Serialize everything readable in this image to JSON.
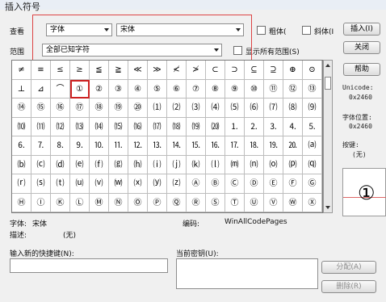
{
  "window": {
    "title": "插入符号"
  },
  "toolbar": {
    "view_label": "查看",
    "view_value": "字体",
    "font_value": "宋体",
    "bold_label": "粗体(",
    "italic_label": "斜体(I",
    "range_label": "范围",
    "range_value": "全部已知字符",
    "show_all_label": "显示所有范围(S)"
  },
  "buttons": {
    "insert": "插入(I)",
    "close": "关闭",
    "help": "帮助",
    "assign": "分配(A)",
    "delete": "删除(R)"
  },
  "symbols": [
    "≠",
    "≡",
    "≤",
    "≥",
    "≦",
    "≧",
    "≪",
    "≫",
    "≮",
    "≯",
    "⊂",
    "⊃",
    "⊆",
    "⊇",
    "⊕",
    "⊙",
    "⊥",
    "⊿",
    "⌒",
    "①",
    "②",
    "③",
    "④",
    "⑤",
    "⑥",
    "⑦",
    "⑧",
    "⑨",
    "⑩",
    "⑪",
    "⑫",
    "⑬",
    "⑭",
    "⑮",
    "⑯",
    "⑰",
    "⑱",
    "⑲",
    "⑳",
    "⑴",
    "⑵",
    "⑶",
    "⑷",
    "⑸",
    "⑹",
    "⑺",
    "⑻",
    "⑼",
    "⑽",
    "⑾",
    "⑿",
    "⒀",
    "⒁",
    "⒂",
    "⒃",
    "⒄",
    "⒅",
    "⒆",
    "⒇",
    "⒈",
    "⒉",
    "⒊",
    "⒋",
    "⒌",
    "⒍",
    "⒎",
    "⒏",
    "⒐",
    "⒑",
    "⒒",
    "⒓",
    "⒔",
    "⒕",
    "⒖",
    "⒗",
    "⒘",
    "⒙",
    "⒚",
    "⒛",
    "⒜",
    "⒝",
    "⒞",
    "⒟",
    "⒠",
    "⒡",
    "⒢",
    "⒣",
    "⒤",
    "⒥",
    "⒦",
    "⒧",
    "⒨",
    "⒩",
    "⒪",
    "⒫",
    "⒬",
    "⒭",
    "⒮",
    "⒯",
    "⒰",
    "⒱",
    "⒲",
    "⒳",
    "⒴",
    "⒵",
    "Ⓐ",
    "Ⓑ",
    "Ⓒ",
    "Ⓓ",
    "Ⓔ",
    "Ⓕ",
    "Ⓖ",
    "Ⓗ",
    "Ⓘ",
    "Ⓚ",
    "Ⓛ",
    "Ⓜ",
    "Ⓝ",
    "Ⓞ",
    "Ⓟ",
    "Ⓠ",
    "Ⓡ",
    "Ⓢ",
    "Ⓣ",
    "Ⓤ",
    "Ⓥ",
    "Ⓦ",
    "Ⓧ"
  ],
  "selected_symbol": "①",
  "side": {
    "unicode_label": "Unicode:",
    "unicode_value": "0x2460",
    "pos_label": "字体位置:",
    "pos_value": "0x2460",
    "key_label": "按键:",
    "key_value": "(无)"
  },
  "info": {
    "font_label": "字体:",
    "font_value": "宋体",
    "code_label": "编码:",
    "code_value": "WinAllCodePages",
    "desc_label": "描述:",
    "desc_value": "(无)"
  },
  "shortcut": {
    "new_label": "输入新的快捷键(N):",
    "current_label": "当前密钥(U):"
  }
}
